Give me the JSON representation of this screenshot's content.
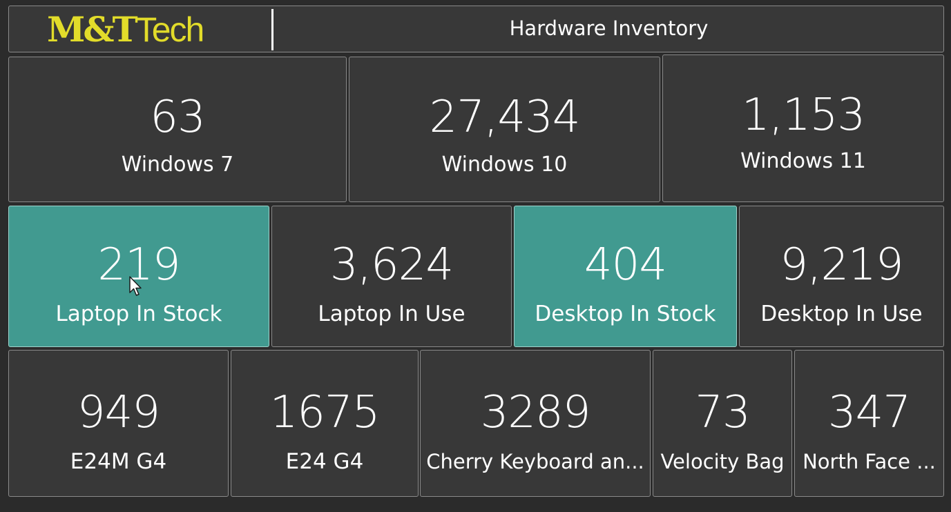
{
  "header": {
    "logo_bold": "M&T",
    "logo_light": "Tech",
    "title": "Hardware Inventory"
  },
  "os_row": [
    {
      "value": "63",
      "label": "Windows 7"
    },
    {
      "value": "27,434",
      "label": "Windows 10"
    },
    {
      "value": "1,153",
      "label": "Windows 11"
    }
  ],
  "device_row": [
    {
      "value": "219",
      "label": "Laptop In Stock"
    },
    {
      "value": "3,624",
      "label": "Laptop In Use"
    },
    {
      "value": "404",
      "label": "Desktop In Stock"
    },
    {
      "value": "9,219",
      "label": "Desktop In Use"
    }
  ],
  "accessory_row": [
    {
      "value": "949",
      "label": "E24M G4"
    },
    {
      "value": "1675",
      "label": "E24 G4"
    },
    {
      "value": "3289",
      "label": "Cherry Keyboard an..."
    },
    {
      "value": "73",
      "label": "Velocity Bag"
    },
    {
      "value": "347",
      "label": "North Face ..."
    }
  ],
  "colors": {
    "background": "#2b2b2b",
    "tile": "#383838",
    "highlight_tile": "#419a90",
    "logo": "#e2dc2a",
    "text": "#ffffff"
  },
  "icons": {
    "cursor": "mouse-pointer-icon"
  }
}
